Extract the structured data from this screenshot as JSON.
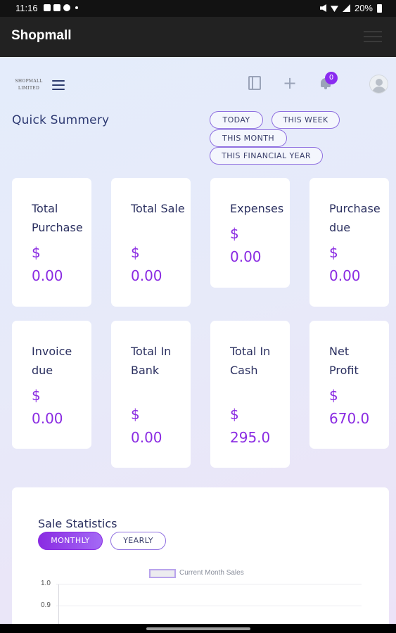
{
  "status_bar": {
    "time": "11:16",
    "battery": "20%",
    "icons": [
      "image-icon",
      "chat-icon",
      "info-icon",
      "mute-icon",
      "wifi-icon",
      "signal-icon",
      "battery-icon"
    ]
  },
  "app_bar": {
    "title": "Shopmall",
    "menu_icon": "hamburger-icon"
  },
  "header": {
    "brand_line1": "SHOPMALL",
    "brand_line2": "LIMITED",
    "notification_count": "0",
    "icons": [
      "menu-icon",
      "notebook-icon",
      "plus-icon",
      "bell-icon",
      "avatar-icon"
    ]
  },
  "summary": {
    "title": "Quick Summery",
    "filters": [
      "TODAY",
      "THIS WEEK",
      "THIS MONTH",
      "THIS FINANCIAL YEAR"
    ],
    "cards": [
      {
        "label": "Total Purchase",
        "currency": "$",
        "value": "0.00"
      },
      {
        "label": "Total Sale",
        "currency": "$",
        "value": "0.00"
      },
      {
        "label": "Expenses",
        "currency": "$",
        "value": "0.00"
      },
      {
        "label": "Purchase due",
        "currency": "$",
        "value": "0.00"
      },
      {
        "label": "Invoice due",
        "currency": "$",
        "value": "0.00"
      },
      {
        "label": "Total In Bank",
        "currency": "$",
        "value": "0.00"
      },
      {
        "label": "Total In Cash",
        "currency": "$",
        "value": "295.0"
      },
      {
        "label": "Net Profit",
        "currency": "$",
        "value": "670.0"
      }
    ]
  },
  "sale_statistics": {
    "title": "Sale Statistics",
    "tabs": [
      "MONTHLY",
      "YEARLY"
    ],
    "active_tab": "MONTHLY",
    "legend": "Current Month Sales",
    "y_ticks": [
      "1.0",
      "0.9"
    ]
  },
  "colors": {
    "accent": "#8a2be2",
    "app_bar": "#222222",
    "text_dark": "#2b3060"
  }
}
